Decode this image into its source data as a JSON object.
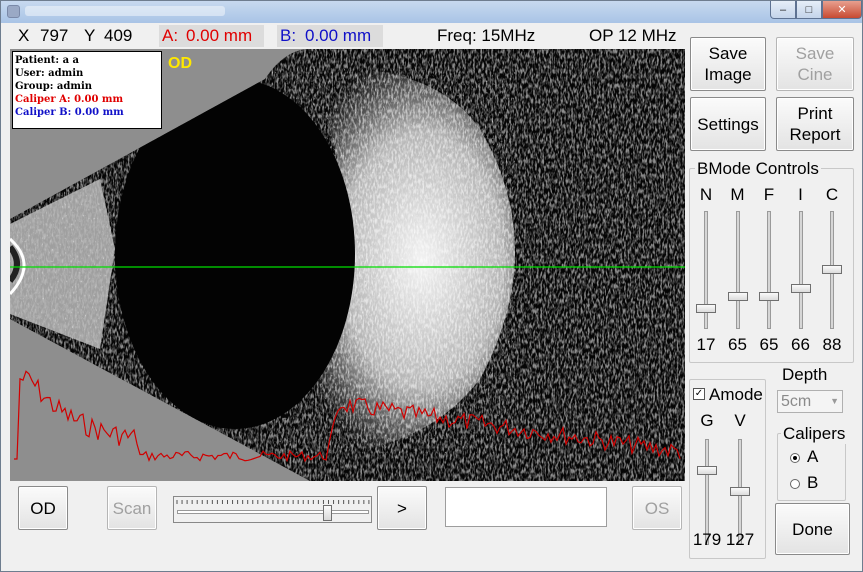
{
  "header": {
    "x_label": "X",
    "x_value": "797",
    "y_label": "Y",
    "y_value": "409",
    "caliper_a_label": "A:",
    "caliper_a_value": "0.00 mm",
    "caliper_b_label": "B:",
    "caliper_b_value": "0.00 mm",
    "freq": "Freq: 15MHz",
    "op": "OP 12 MHz"
  },
  "info": {
    "patient": "Patient: a a",
    "user": "User: admin",
    "group": "Group: admin",
    "caliper_a": "Caliper A: 0.00 mm",
    "caliper_b": "Caliper B: 0.00 mm"
  },
  "eye_label": "OD",
  "buttons": {
    "save_image": "Save Image",
    "save_cine": "Save Cine",
    "settings": "Settings",
    "print_report": "Print Report",
    "od": "OD",
    "scan": "Scan",
    "next": ">",
    "os": "OS",
    "done": "Done"
  },
  "bmode": {
    "title": "BMode Controls",
    "sliders": [
      {
        "label": "N",
        "value": "17",
        "level": 0.17
      },
      {
        "label": "M",
        "value": "65",
        "level": 0.27
      },
      {
        "label": "F",
        "value": "65",
        "level": 0.27
      },
      {
        "label": "I",
        "value": "66",
        "level": 0.34
      },
      {
        "label": "C",
        "value": "88",
        "level": 0.5
      }
    ]
  },
  "amode": {
    "label": "Amode",
    "checked": true,
    "sliders": [
      {
        "label": "G",
        "value": "179",
        "level": 0.7
      },
      {
        "label": "V",
        "value": "127",
        "level": 0.5
      }
    ]
  },
  "depth": {
    "label": "Depth",
    "value": "5cm"
  },
  "calipers": {
    "title": "Calipers",
    "options": [
      "A",
      "B"
    ],
    "selected": "A"
  },
  "cine": {
    "position": 0.8
  },
  "colors": {
    "caliper_a": "#e00000",
    "caliper_b": "#1010c8",
    "eye_label": "#ffe800",
    "amode_trace": "#d00000",
    "guide_line": "#00dd00"
  },
  "icons": {
    "minimize": "minimize-icon",
    "maximize": "maximize-icon",
    "close": "close-icon"
  }
}
